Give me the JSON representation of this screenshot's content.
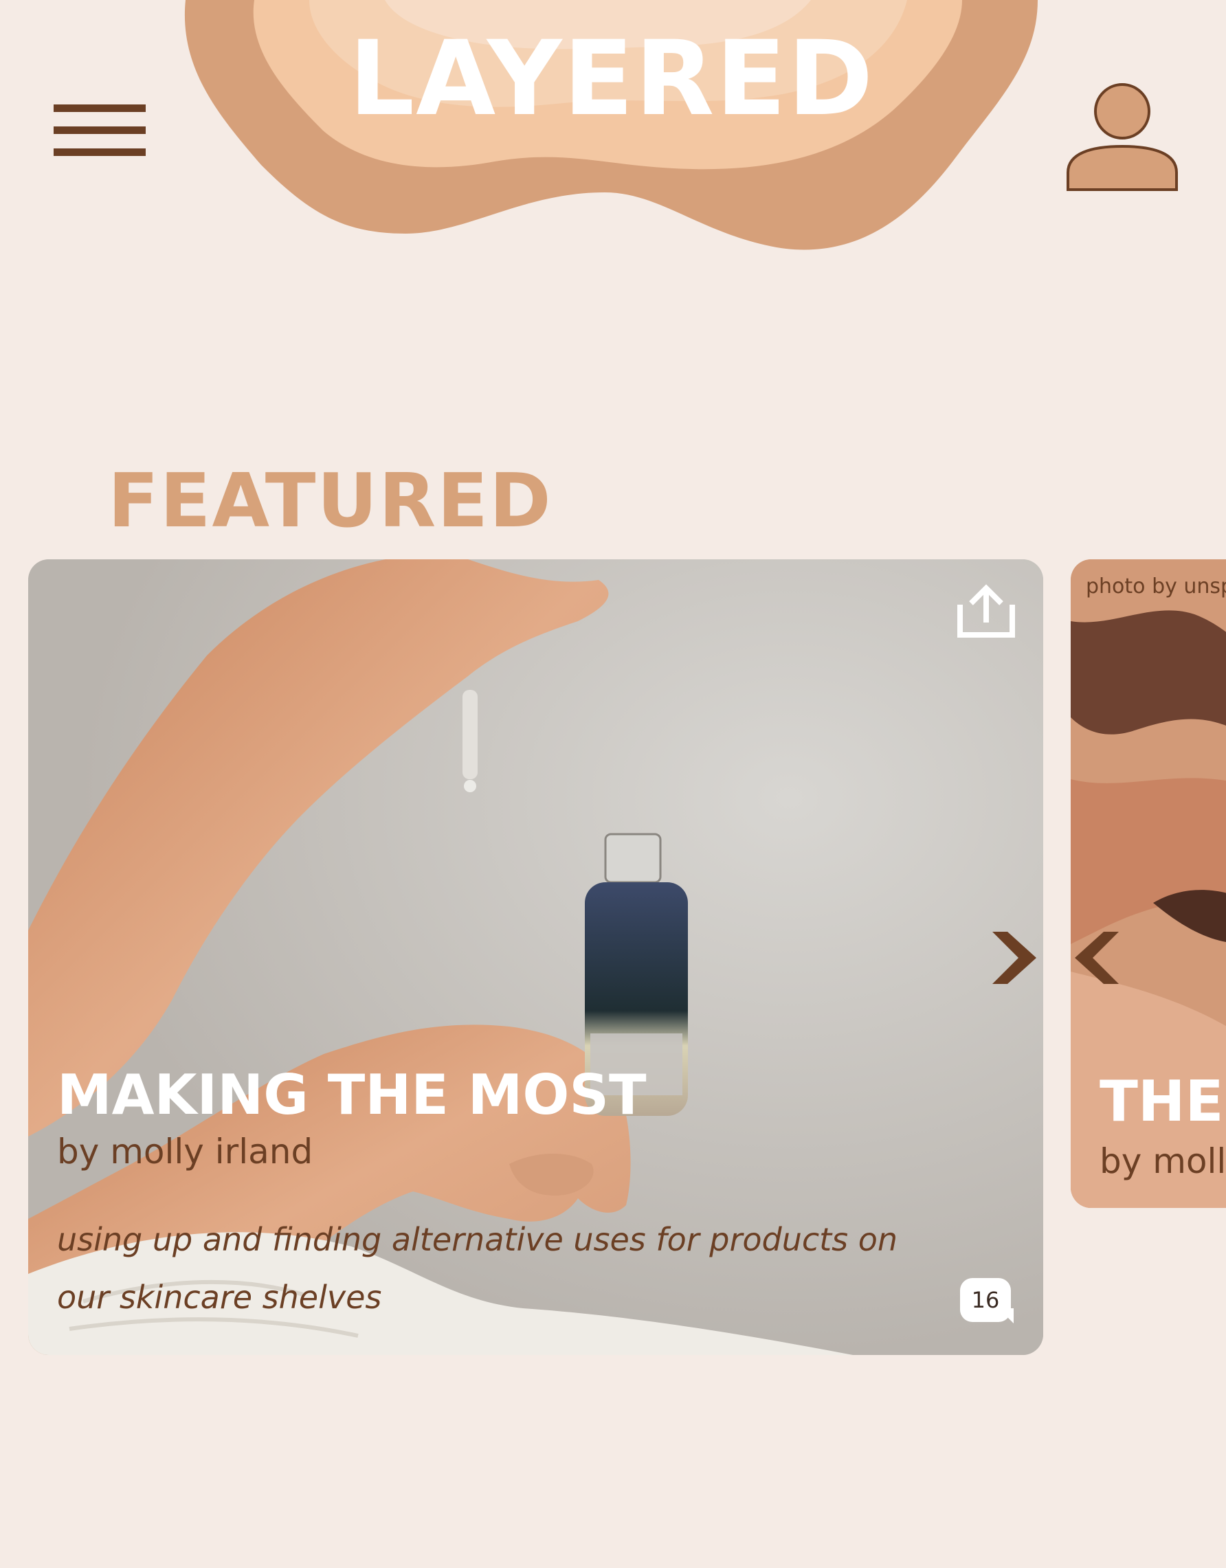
{
  "app": {
    "title": "LAYERED"
  },
  "header": {
    "menu_icon": "hamburger-menu-icon",
    "profile_icon": "user-profile-icon"
  },
  "featured": {
    "heading": "FEATURED",
    "cards": [
      {
        "title": "MAKING THE MOST",
        "author": "by molly irland",
        "description": "using up and finding alternative uses for products on our skincare shelves",
        "comment_count": "16",
        "share_icon": "share-icon"
      },
      {
        "photo_credit": "photo by unspl",
        "title": "THE",
        "author": "by molly"
      }
    ],
    "next_icon": "chevron-right-icon",
    "prev_icon": "chevron-left-icon"
  },
  "colors": {
    "background": "#f5ebe5",
    "accent": "#d7a27a",
    "dark_brown": "#6b3f24",
    "blob_light": "#f3c7a2",
    "blob_mid": "#e9b48c"
  }
}
